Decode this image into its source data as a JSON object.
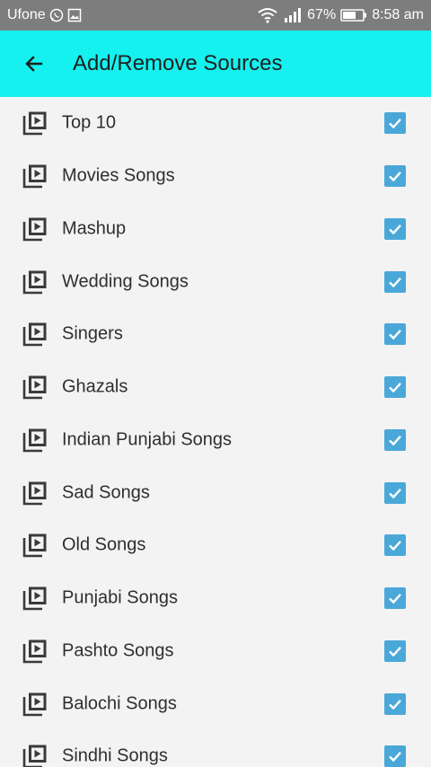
{
  "status_bar": {
    "carrier": "Ufone",
    "battery": "67%",
    "time": "8:58 am"
  },
  "app_bar": {
    "title": "Add/Remove Sources"
  },
  "sources": [
    {
      "label": "Top 10",
      "checked": true
    },
    {
      "label": "Movies Songs",
      "checked": true
    },
    {
      "label": "Mashup",
      "checked": true
    },
    {
      "label": "Wedding Songs",
      "checked": true
    },
    {
      "label": "Singers",
      "checked": true
    },
    {
      "label": "Ghazals",
      "checked": true
    },
    {
      "label": "Indian Punjabi Songs",
      "checked": true
    },
    {
      "label": "Sad Songs",
      "checked": true
    },
    {
      "label": "Old Songs",
      "checked": true
    },
    {
      "label": "Punjabi Songs",
      "checked": true
    },
    {
      "label": "Pashto Songs",
      "checked": true
    },
    {
      "label": "Balochi Songs",
      "checked": true
    },
    {
      "label": "Sindhi Songs",
      "checked": true
    }
  ],
  "colors": {
    "app_bar": "#14f1ee",
    "status_bar": "#7d7d7d",
    "checkbox": "#4aa8d8",
    "background": "#f3f3f3"
  },
  "icons": {
    "row": "video-library-icon",
    "back": "arrow-left-icon",
    "check": "checkbox-checked-icon"
  }
}
